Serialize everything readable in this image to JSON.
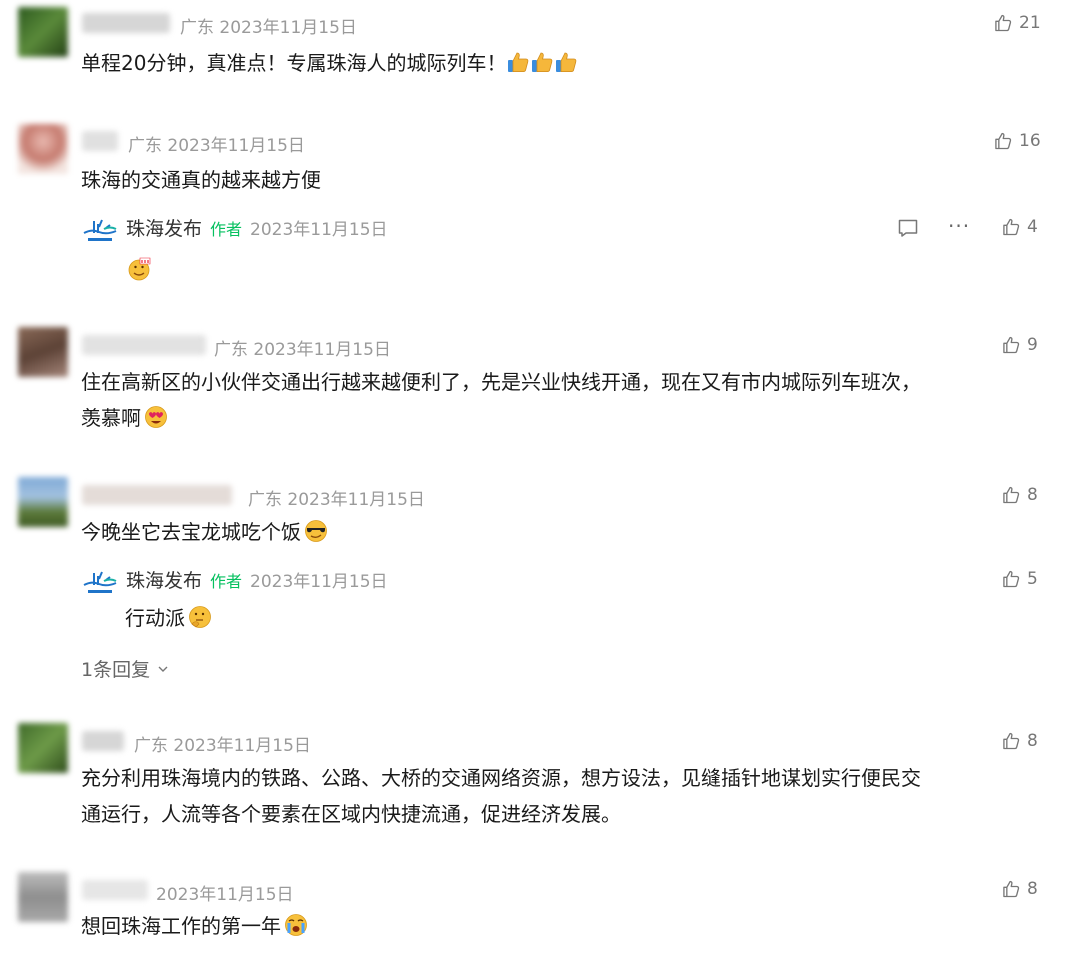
{
  "colors": {
    "author_tag": "#07c160",
    "meta": "#9a9a9a",
    "text": "#1a1a1a"
  },
  "comments": [
    {
      "location": "广东",
      "date": "2023年11月15日",
      "likes": "21",
      "text": "单程20分钟，真准点！专属珠海人的城际列车！"
    },
    {
      "location": "广东",
      "date": "2023年11月15日",
      "likes": "16",
      "text": "珠海的交通真的越来越方便"
    },
    {
      "location": "广东",
      "date": "2023年11月15日",
      "likes": "9",
      "text_line1": "住在高新区的小伙伴交通出行越来越便利了，先是兴业快线开通，现在又有市内城际列车班次，",
      "text_line2": "羡慕啊"
    },
    {
      "location": "广东",
      "date": "2023年11月15日",
      "likes": "8",
      "text": "今晚坐它去宝龙城吃个饭"
    },
    {
      "location": "广东",
      "date": "2023年11月15日",
      "likes": "8",
      "text_line1": "充分利用珠海境内的铁路、公路、大桥的交通网络资源，想方设法，见缝插针地谋划实行便民交",
      "text_line2": "通运行，人流等各个要素在区域内快捷流通，促进经济发展。"
    },
    {
      "date": "2023年11月15日",
      "likes": "8",
      "text": "想回珠海工作的第一年"
    }
  ],
  "author_replies": [
    {
      "name": "珠海发布",
      "tag": "作者",
      "date": "2023年11月15日",
      "likes": "4"
    },
    {
      "name": "珠海发布",
      "tag": "作者",
      "date": "2023年11月15日",
      "likes": "5",
      "text": "行动派"
    }
  ],
  "reply_toggle": "1条回复",
  "icons": [
    "thumb-up-icon",
    "comment-icon",
    "more-icon",
    "chevron-down-icon",
    "zhuhai-logo-icon"
  ]
}
